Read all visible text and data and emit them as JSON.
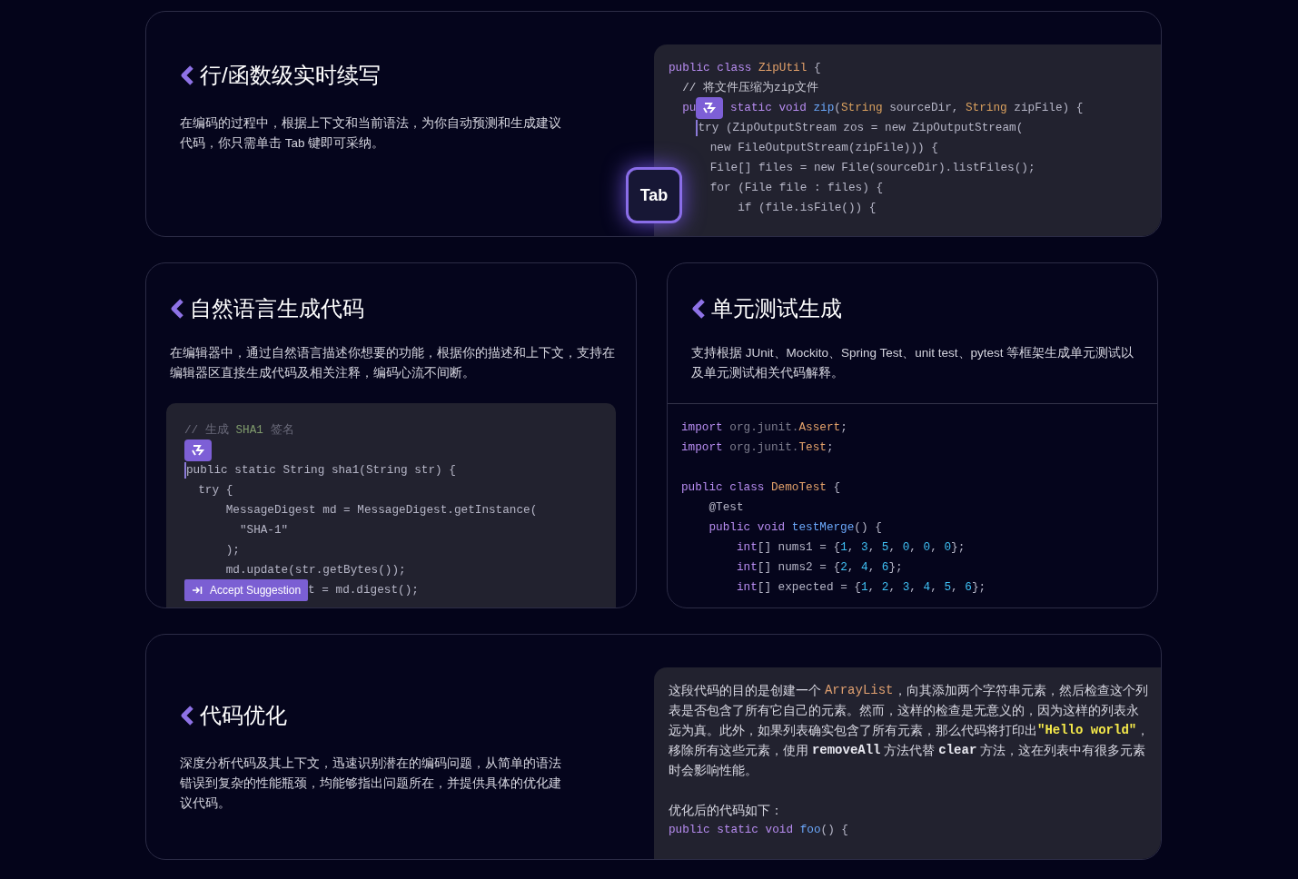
{
  "features": [
    {
      "title": "行/函数级实时续写",
      "description": "在编码的过程中，根据上下文和当前语法，为你自动预测和生成建议代码，你只需单击 Tab 键即可采纳。",
      "tab_key": "Tab",
      "code_lines": [
        {
          "tokens": [
            {
              "text": "public class ",
              "kind": "kw"
            },
            {
              "text": "ZipUtil",
              "kind": "cls"
            },
            {
              "text": " {",
              "kind": "p"
            }
          ]
        },
        {
          "tokens": [
            {
              "text": "  // 将文件压缩为zip文件",
              "kind": "cmw"
            }
          ]
        },
        {
          "tokens": [
            {
              "text": "  pu",
              "kind": "kw"
            },
            {
              "kind": "logo"
            },
            {
              "text": " static void ",
              "kind": "kw"
            },
            {
              "text": "zip",
              "kind": "fn"
            },
            {
              "text": "(",
              "kind": "p"
            },
            {
              "text": "String",
              "kind": "ty"
            },
            {
              "text": " sourceDir, ",
              "kind": "p"
            },
            {
              "text": "String",
              "kind": "ty"
            },
            {
              "text": " zipFile) {",
              "kind": "p"
            }
          ]
        },
        {
          "tokens": [
            {
              "text": "    try (ZipOutputStream zos = new ZipOutputStream(",
              "kind": "p",
              "cursor": true
            }
          ]
        },
        {
          "tokens": [
            {
              "text": "      new FileOutputStream(zipFile))) {",
              "kind": "p"
            }
          ]
        },
        {
          "tokens": [
            {
              "text": "      File[] files = new File(sourceDir).listFiles();",
              "kind": "p"
            }
          ]
        },
        {
          "tokens": [
            {
              "text": "      for (File file : files) {",
              "kind": "p"
            }
          ]
        },
        {
          "tokens": [
            {
              "text": "          if (file.isFile()) {",
              "kind": "p"
            }
          ]
        }
      ]
    },
    {
      "title": "自然语言生成代码",
      "description": "在编辑器中，通过自然语言描述你想要的功能，根据你的描述和上下文，支持在编辑器区直接生成代码及相关注释，编码心流不间断。",
      "code_lines": [
        {
          "tokens": [
            {
              "text": "// 生成 ",
              "kind": "cm"
            },
            {
              "text": "SHA1",
              "kind": "cmg"
            },
            {
              "text": " 签名",
              "kind": "cm"
            }
          ]
        },
        {
          "tokens": [
            {
              "kind": "logo"
            }
          ]
        },
        {
          "tokens": [
            {
              "text": "public static String sha1(String str) {",
              "kind": "p",
              "cursor": true
            }
          ]
        },
        {
          "tokens": [
            {
              "text": "  try {",
              "kind": "p"
            }
          ]
        },
        {
          "tokens": [
            {
              "text": "      MessageDigest md = MessageDigest.getInstance(",
              "kind": "p"
            }
          ]
        },
        {
          "tokens": [
            {
              "text": "        \"SHA-1\"",
              "kind": "p"
            }
          ]
        },
        {
          "tokens": [
            {
              "text": "      );",
              "kind": "p"
            }
          ]
        },
        {
          "tokens": [
            {
              "text": "      md.update(str.getBytes());",
              "kind": "p"
            }
          ]
        },
        {
          "tokens": [
            {
              "text": "Accept Suggestion",
              "kind": "button"
            },
            {
              "text": "t = md.digest();",
              "kind": "p"
            }
          ]
        }
      ]
    },
    {
      "title": "单元测试生成",
      "description": "支持根据 JUnit、Mockito、Spring Test、unit test、pytest 等框架生成单元测试以及单元测试相关代码解释。",
      "import_lines": [
        {
          "tokens": [
            {
              "text": "import ",
              "kind": "kw"
            },
            {
              "text": "org.junit.",
              "kind": "pk"
            },
            {
              "text": "Assert",
              "kind": "cls"
            },
            {
              "text": ";",
              "kind": "p"
            }
          ]
        },
        {
          "tokens": [
            {
              "text": "import ",
              "kind": "kw"
            },
            {
              "text": "org.junit.",
              "kind": "pk"
            },
            {
              "text": "Test",
              "kind": "cls"
            },
            {
              "text": ";",
              "kind": "p"
            }
          ]
        }
      ],
      "code_lines": [
        {
          "tokens": [
            {
              "text": "public class ",
              "kind": "kw"
            },
            {
              "text": "DemoTest",
              "kind": "cls"
            },
            {
              "text": " {",
              "kind": "p"
            }
          ]
        },
        {
          "tokens": [
            {
              "text": "    @Test",
              "kind": "p"
            }
          ]
        },
        {
          "tokens": [
            {
              "text": "    public void ",
              "kind": "kw"
            },
            {
              "text": "testMerge",
              "kind": "fn"
            },
            {
              "text": "() {",
              "kind": "p"
            }
          ]
        },
        {
          "tokens": [
            {
              "text": "        int",
              "kind": "kw"
            },
            {
              "text": "[] nums1 = {",
              "kind": "p"
            },
            {
              "text": "1",
              "kind": "num"
            },
            {
              "text": ", ",
              "kind": "p"
            },
            {
              "text": "3",
              "kind": "num"
            },
            {
              "text": ", ",
              "kind": "p"
            },
            {
              "text": "5",
              "kind": "num"
            },
            {
              "text": ", ",
              "kind": "p"
            },
            {
              "text": "0",
              "kind": "num"
            },
            {
              "text": ", ",
              "kind": "p"
            },
            {
              "text": "0",
              "kind": "num"
            },
            {
              "text": ", ",
              "kind": "p"
            },
            {
              "text": "0",
              "kind": "num"
            },
            {
              "text": "};",
              "kind": "p"
            }
          ]
        },
        {
          "tokens": [
            {
              "text": "        int",
              "kind": "kw"
            },
            {
              "text": "[] nums2 = {",
              "kind": "p"
            },
            {
              "text": "2",
              "kind": "num"
            },
            {
              "text": ", ",
              "kind": "p"
            },
            {
              "text": "4",
              "kind": "num"
            },
            {
              "text": ", ",
              "kind": "p"
            },
            {
              "text": "6",
              "kind": "num"
            },
            {
              "text": "};",
              "kind": "p"
            }
          ]
        },
        {
          "tokens": [
            {
              "text": "        int",
              "kind": "kw"
            },
            {
              "text": "[] expected = {",
              "kind": "p"
            },
            {
              "text": "1",
              "kind": "num"
            },
            {
              "text": ", ",
              "kind": "p"
            },
            {
              "text": "2",
              "kind": "num"
            },
            {
              "text": ", ",
              "kind": "p"
            },
            {
              "text": "3",
              "kind": "num"
            },
            {
              "text": ", ",
              "kind": "p"
            },
            {
              "text": "4",
              "kind": "num"
            },
            {
              "text": ", ",
              "kind": "p"
            },
            {
              "text": "5",
              "kind": "num"
            },
            {
              "text": ", ",
              "kind": "p"
            },
            {
              "text": "6",
              "kind": "num"
            },
            {
              "text": "};",
              "kind": "p"
            }
          ]
        }
      ]
    },
    {
      "title": "代码优化",
      "description": "深度分析代码及其上下文，迅速识别潜在的编码问题，从简单的语法错误到复杂的性能瓶颈，均能够指出问题所在，并提供具体的优化建议代码。",
      "answer_lines": [
        {
          "tokens": [
            {
              "text": "这段代码的目的是创建一个 ",
              "kind": "tx"
            },
            {
              "text": "ArrayList",
              "kind": "ccls"
            },
            {
              "text": "，向其添加两个字符串元素，然后检查这个列",
              "kind": "tx"
            }
          ]
        },
        {
          "tokens": [
            {
              "text": "表是否包含了所有它自己的元素。然而，这样的检查是无意义的，因为这样的列表永",
              "kind": "tx"
            }
          ]
        },
        {
          "tokens": [
            {
              "text": "远为真。此外，如果列表确实包含了所有元素，那么代码将打印出",
              "kind": "tx"
            },
            {
              "text": "\"Hello world\"",
              "kind": "cstr"
            },
            {
              "text": "，",
              "kind": "tx"
            }
          ]
        },
        {
          "tokens": [
            {
              "text": "移除所有这些元素，使用 ",
              "kind": "tx"
            },
            {
              "text": "removeAll",
              "kind": "code"
            },
            {
              "text": " 方法代替 ",
              "kind": "tx"
            },
            {
              "text": "clear",
              "kind": "code"
            },
            {
              "text": " 方法，这在列表中有很多元素",
              "kind": "tx"
            }
          ]
        },
        {
          "tokens": [
            {
              "text": "时会影响性能。",
              "kind": "tx"
            }
          ]
        }
      ],
      "code_intro": "优化后的代码如下：",
      "code_line": {
        "tokens": [
          {
            "text": "public static void ",
            "kind": "kw"
          },
          {
            "text": "foo",
            "kind": "fn"
          },
          {
            "text": "() {",
            "kind": "p"
          }
        ]
      }
    }
  ]
}
